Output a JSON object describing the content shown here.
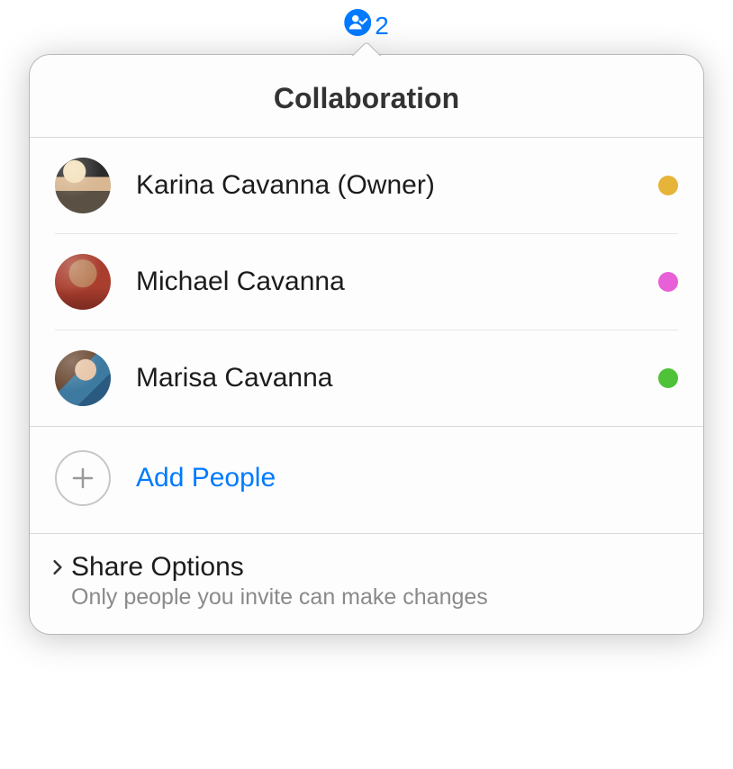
{
  "badge": {
    "count": "2"
  },
  "popover": {
    "title": "Collaboration",
    "people": [
      {
        "name": "Karina Cavanna (Owner)",
        "presence_color": "#e7b43a",
        "avatar_class": "avatar-1"
      },
      {
        "name": "Michael Cavanna",
        "presence_color": "#e860d7",
        "avatar_class": "avatar-2"
      },
      {
        "name": "Marisa Cavanna",
        "presence_color": "#4fc23a",
        "avatar_class": "avatar-3"
      }
    ],
    "add_people_label": "Add People",
    "share_options": {
      "title": "Share Options",
      "subtitle": "Only people you invite can make changes"
    }
  },
  "colors": {
    "accent": "#007aff"
  }
}
